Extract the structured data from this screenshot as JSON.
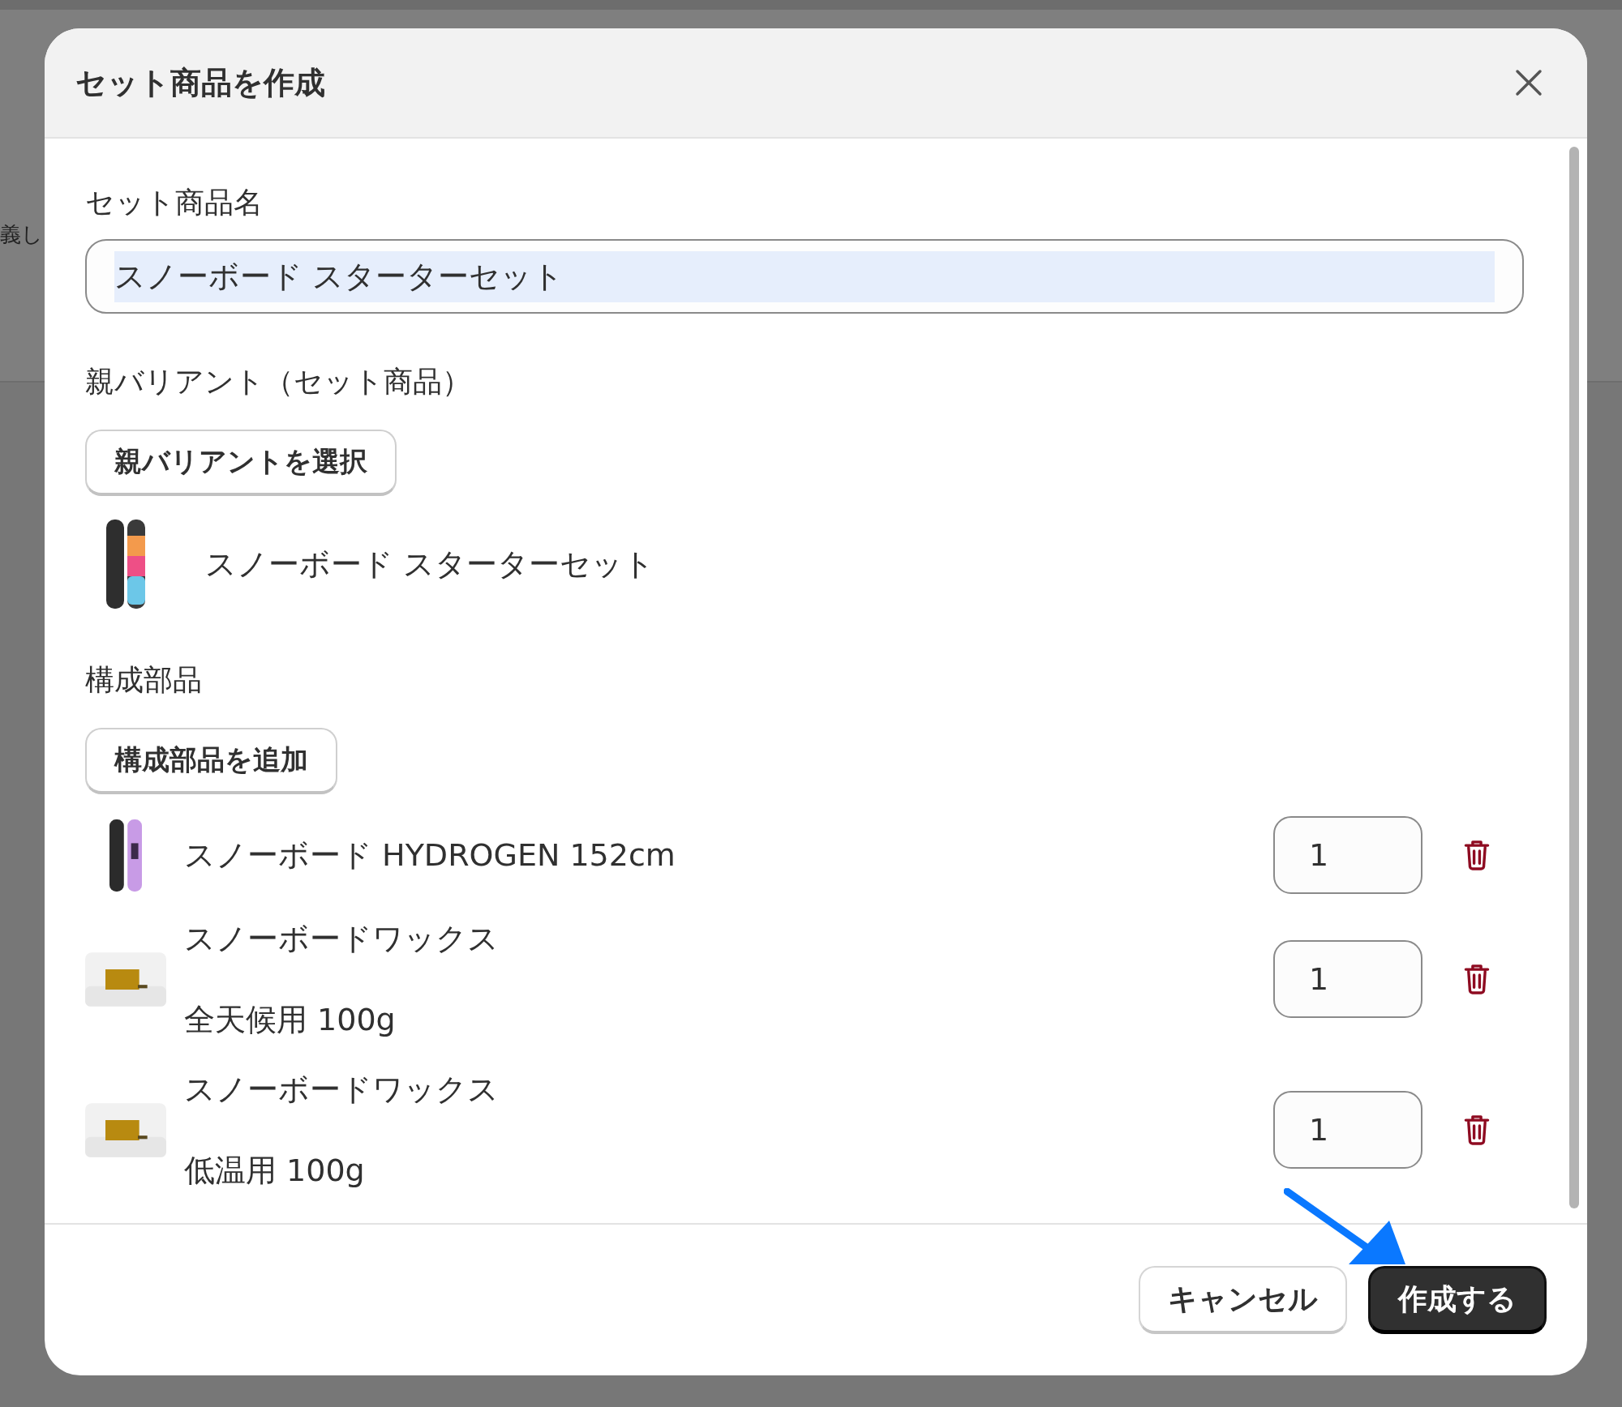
{
  "background_text": "義し",
  "dialog": {
    "title": "セット商品を作成",
    "name_field": {
      "label": "セット商品名",
      "value": "スノーボード スターターセット",
      "selected": true
    },
    "parent": {
      "label": "親バリアント（セット商品）",
      "button": "親バリアントを選択",
      "item": {
        "kind": "board",
        "name": "スノーボード スターターセット"
      }
    },
    "components": {
      "label": "構成部品",
      "button": "構成部品を追加",
      "items": [
        {
          "kind": "board2",
          "name": "スノーボード HYDROGEN 152cm",
          "quantity": "1"
        },
        {
          "kind": "wax",
          "name": "スノーボードワックス",
          "variant": "全天候用 100g",
          "quantity": "1"
        },
        {
          "kind": "wax",
          "name": "スノーボードワックス",
          "variant": "低温用 100g",
          "quantity": "1"
        }
      ]
    },
    "buttons": [
      {
        "kind": "secondary",
        "label": "キャンセル"
      },
      {
        "kind": "primary",
        "label": "作成する"
      }
    ]
  }
}
